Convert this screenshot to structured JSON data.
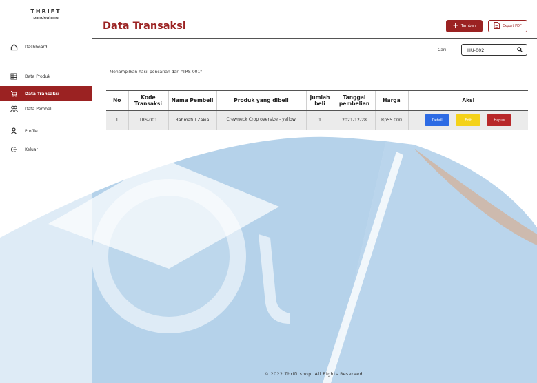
{
  "brand": {
    "title": "THRIFT",
    "subtitle": "pandeglang"
  },
  "sidebar": {
    "items": [
      {
        "label": "Dashboard",
        "icon": "home-icon",
        "active": false
      },
      {
        "label": "Data Produk",
        "icon": "product-icon",
        "active": false
      },
      {
        "label": "Data Transaksi",
        "icon": "cart-icon",
        "active": true
      },
      {
        "label": "Data Pembeli",
        "icon": "users-icon",
        "active": false
      },
      {
        "label": "Profile",
        "icon": "user-icon",
        "active": false
      },
      {
        "label": "Keluar",
        "icon": "logout-icon",
        "active": false
      }
    ]
  },
  "header": {
    "title": "Data Transaksi",
    "add_label": "Tambah",
    "export_label": "Export PDF"
  },
  "search": {
    "label": "Cari",
    "value": "HU-002"
  },
  "result_text": "Menampilkan hasil pencarian dari \"TRS-001\"",
  "table": {
    "headers": [
      "No",
      "Kode Transaksi",
      "Nama Pembeli",
      "Produk yang dibeli",
      "Jumlah beli",
      "Tanggal pembelian",
      "Harga",
      "Aksi"
    ],
    "rows": [
      {
        "no": "1",
        "kode": "TRS-001",
        "nama": "Rahmatul Zakia",
        "produk": "Crewneck Crop oversize - yellow",
        "jumlah": "1",
        "tanggal": "2021-12-28",
        "harga": "Rp55.000"
      }
    ],
    "actions": {
      "detail": "Detail",
      "edit": "Edit",
      "hapus": "Hapus"
    }
  },
  "footer": "© 2022 Thrift shop. All Rights Reserved.",
  "colors": {
    "primary": "#9b2222",
    "detail": "#2d6be4",
    "edit": "#f4d21a",
    "hapus": "#b8282a",
    "watermark": "#5b9bd1",
    "watermark_accent": "#f08a3c"
  }
}
